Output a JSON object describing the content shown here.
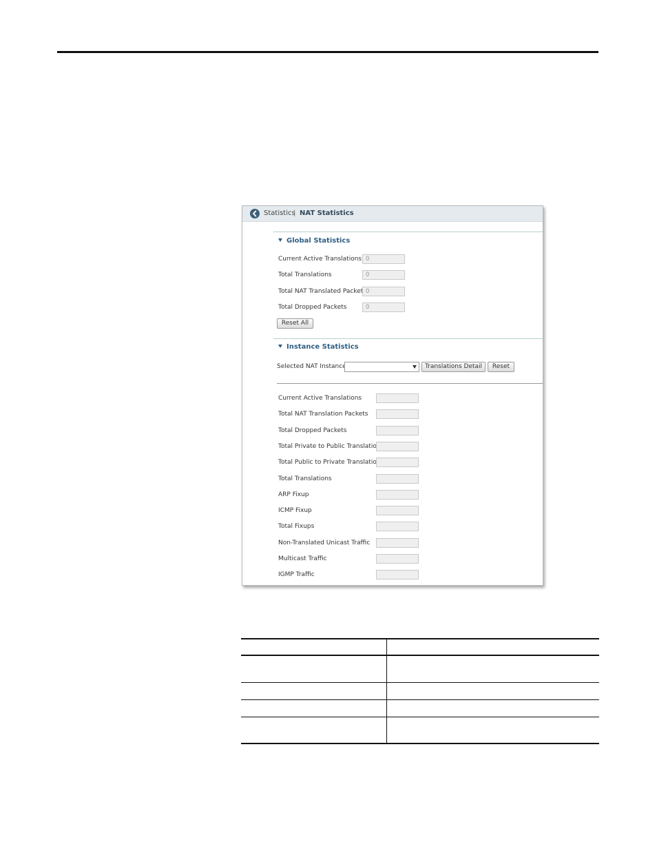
{
  "header": {
    "back_icon": "chevron-left-circle-icon",
    "breadcrumb_link": "Statistics",
    "breadcrumb_separator": "|",
    "title": "NAT Statistics"
  },
  "global": {
    "title": "Global Statistics",
    "rows": [
      {
        "label": "Current Active Translations",
        "value": "0"
      },
      {
        "label": "Total Translations",
        "value": "0"
      },
      {
        "label": "Total NAT Translated Packets",
        "value": "0"
      },
      {
        "label": "Total Dropped Packets",
        "value": "0"
      }
    ],
    "reset_all": "Reset All"
  },
  "instance": {
    "title": "Instance Statistics",
    "selected_label": "Selected NAT Instance:",
    "selected_value": "",
    "translations_detail": "Translations Detail",
    "reset": "Reset",
    "rows": [
      {
        "label": "Current Active Translations",
        "value": ""
      },
      {
        "label": "Total NAT Translation Packets",
        "value": ""
      },
      {
        "label": "Total Dropped Packets",
        "value": ""
      },
      {
        "label": "Total Private to Public Translations",
        "value": ""
      },
      {
        "label": "Total Public to Private Translations",
        "value": ""
      },
      {
        "label": "Total Translations",
        "value": ""
      },
      {
        "label": "ARP Fixup",
        "value": ""
      },
      {
        "label": "ICMP Fixup",
        "value": ""
      },
      {
        "label": "Total Fixups",
        "value": ""
      },
      {
        "label": "Non-Translated Unicast Traffic",
        "value": ""
      },
      {
        "label": "Multicast Traffic",
        "value": ""
      },
      {
        "label": "IGMP Traffic",
        "value": ""
      }
    ]
  }
}
